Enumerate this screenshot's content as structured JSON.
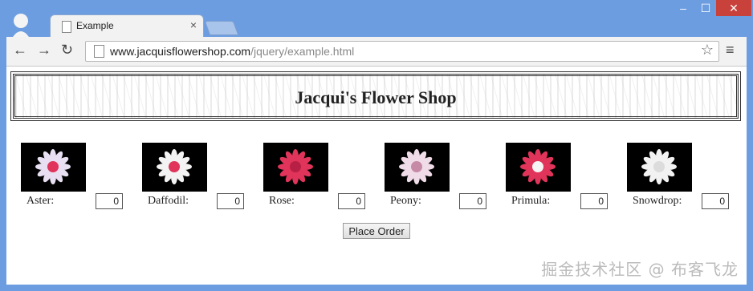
{
  "window": {
    "tab_title": "Example",
    "tab_close": "×",
    "controls": {
      "minimize": "‒",
      "maximize": "☐",
      "close": "✕"
    }
  },
  "toolbar": {
    "back": "←",
    "forward": "→",
    "reload": "↻",
    "url_host": "www.jacquisflowershop.com",
    "url_path": "/jquery/example.html",
    "star": "☆",
    "menu": "≡"
  },
  "page": {
    "title": "Jacqui's Flower Shop",
    "flowers": [
      {
        "label": "Aster:",
        "qty": "0",
        "color": "#e8e0f2",
        "center": "#e0345a"
      },
      {
        "label": "Daffodil:",
        "qty": "0",
        "color": "#f3f3f3",
        "center": "#e0345a"
      },
      {
        "label": "Rose:",
        "qty": "0",
        "color": "#e0345a",
        "center": "#b81f44"
      },
      {
        "label": "Peony:",
        "qty": "0",
        "color": "#f0dce8",
        "center": "#c78aa6"
      },
      {
        "label": "Primula:",
        "qty": "0",
        "color": "#e0345a",
        "center": "#f5f5f5"
      },
      {
        "label": "Snowdrop:",
        "qty": "0",
        "color": "#f2f2f2",
        "center": "#dcdcdc"
      }
    ],
    "order_button": "Place Order"
  },
  "watermark": "掘金技术社区 @ 布客飞龙"
}
